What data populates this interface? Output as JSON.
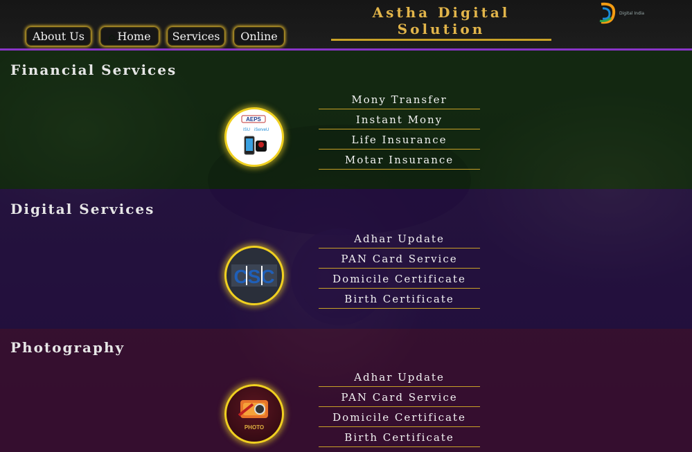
{
  "header": {
    "brand": "Astha Digital Solution",
    "logo_text": "Digital India",
    "nav": [
      {
        "label": "About Us",
        "icon": null
      },
      {
        "label": "Home",
        "icon": "home-icon"
      },
      {
        "label": "Services",
        "icon": null
      },
      {
        "label": "Online",
        "icon": null
      }
    ]
  },
  "sections": [
    {
      "title": "Financial Services",
      "badge": {
        "icon": "aeps-icon",
        "label": "AEPS"
      },
      "items": [
        "Mony Transfer",
        "Instant Mony",
        "Life Insurance",
        "Motar Insurance"
      ]
    },
    {
      "title": "Digital Services",
      "badge": {
        "icon": "csc-icon",
        "label": "CSC"
      },
      "items": [
        "Adhar Update",
        "PAN Card Service",
        "Domicile Certificate",
        "Birth Certificate"
      ]
    },
    {
      "title": "Photography",
      "badge": {
        "icon": "photo-icon",
        "label": "PHOTO"
      },
      "items": [
        "Adhar Update",
        "PAN Card Service",
        "Domicile Certificate",
        "Birth Certificate"
      ]
    }
  ],
  "colors": {
    "accent_gold": "#c9a227",
    "nav_border": "#8a34c8",
    "financial_band": "#0c2d0c",
    "digital_band": "#2d0a5f",
    "photo_band": "#500a46"
  }
}
